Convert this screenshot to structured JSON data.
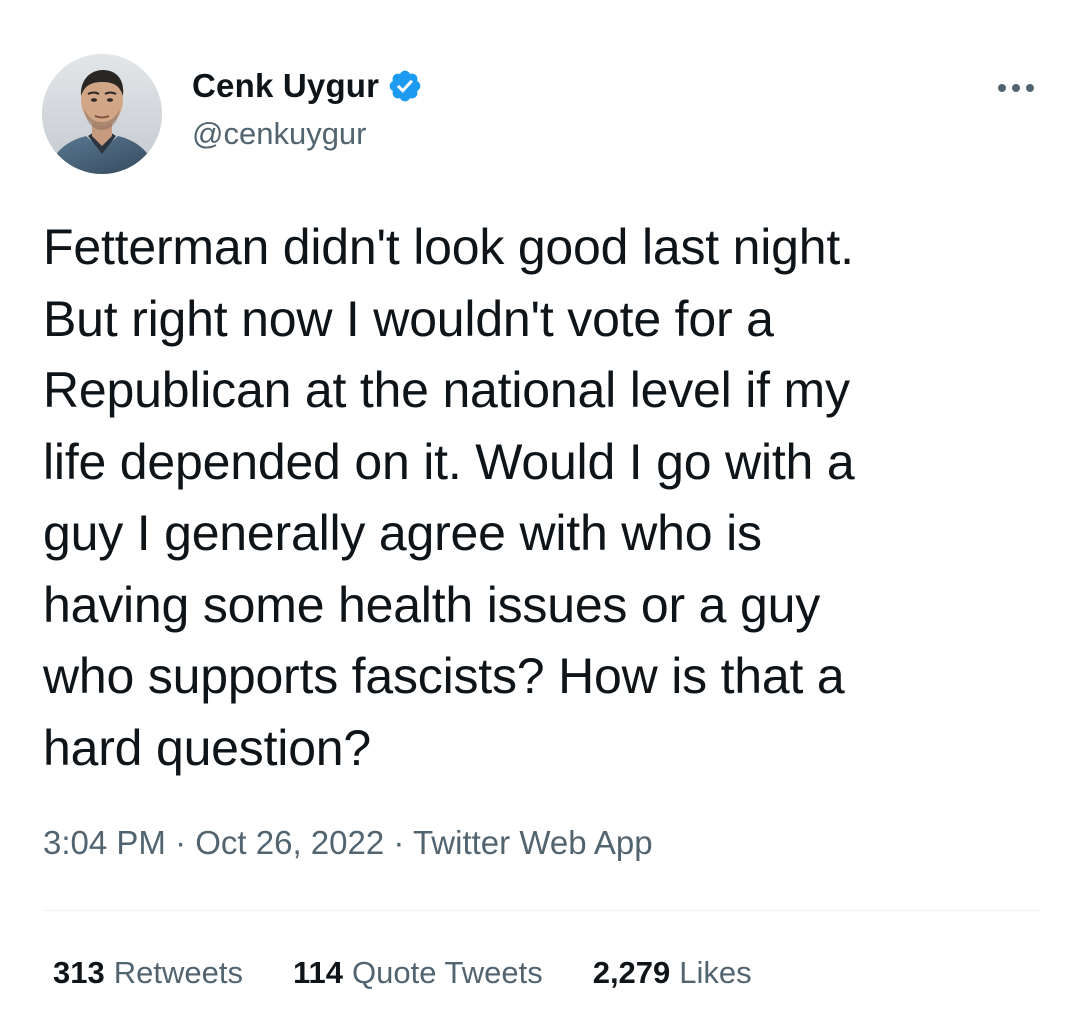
{
  "author": {
    "display_name": "Cenk Uygur",
    "handle": "@cenkuygur",
    "avatar_icon": "profile-photo",
    "verified_icon": "verified-badge-icon",
    "verified_color": "#1d9bf0"
  },
  "more_icon": "more-horizontal-icon",
  "tweet": {
    "text": "Fetterman didn't look good last night.\nBut right now I wouldn't vote for a\nRepublican at the national level if my\nlife depended on it. Would I go with a\nguy I generally agree with who is\nhaving some health issues or a guy\nwho supports fascists? How is that a\nhard question?"
  },
  "meta": {
    "time": "3:04 PM",
    "separator": "·",
    "date": "Oct 26, 2022",
    "source": "Twitter Web App"
  },
  "stats": {
    "retweets_count": "313",
    "retweets_label": "Retweets",
    "quotes_count": "114",
    "quotes_label": "Quote Tweets",
    "likes_count": "2,279",
    "likes_label": "Likes"
  },
  "colors": {
    "primary_text": "#0f1419",
    "secondary_text": "#536471",
    "divider": "#eff3f4",
    "accent": "#1d9bf0"
  }
}
